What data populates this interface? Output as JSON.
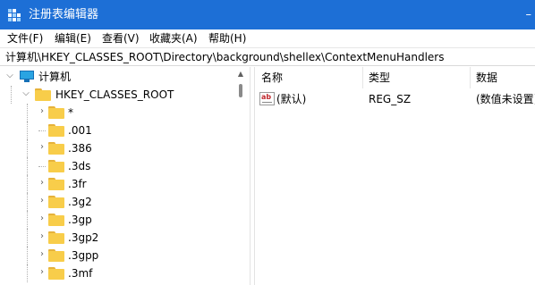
{
  "window": {
    "title": "注册表编辑器",
    "corner_glyph": "–"
  },
  "menu": [
    "文件(F)",
    "编辑(E)",
    "查看(V)",
    "收藏夹(A)",
    "帮助(H)"
  ],
  "address": "计算机\\HKEY_CLASSES_ROOT\\Directory\\background\\shellex\\ContextMenuHandlers",
  "tree": {
    "root": "计算机",
    "hive": "HKEY_CLASSES_ROOT",
    "keys": [
      "*",
      ".001",
      ".386",
      ".3ds",
      ".3fr",
      ".3g2",
      ".3gp",
      ".3gp2",
      ".3gpp",
      ".3mf"
    ]
  },
  "list": {
    "columns": [
      "名称",
      "类型",
      "数据"
    ],
    "rows": [
      {
        "name": "(默认)",
        "type": "REG_SZ",
        "data": "(数值未设置)",
        "icon": "string-value-icon",
        "icon_text": "ab"
      }
    ]
  },
  "colors": {
    "titlebar": "#1d6fd6",
    "folder": "#f8cd4a",
    "computer": "#2aa4e2"
  }
}
